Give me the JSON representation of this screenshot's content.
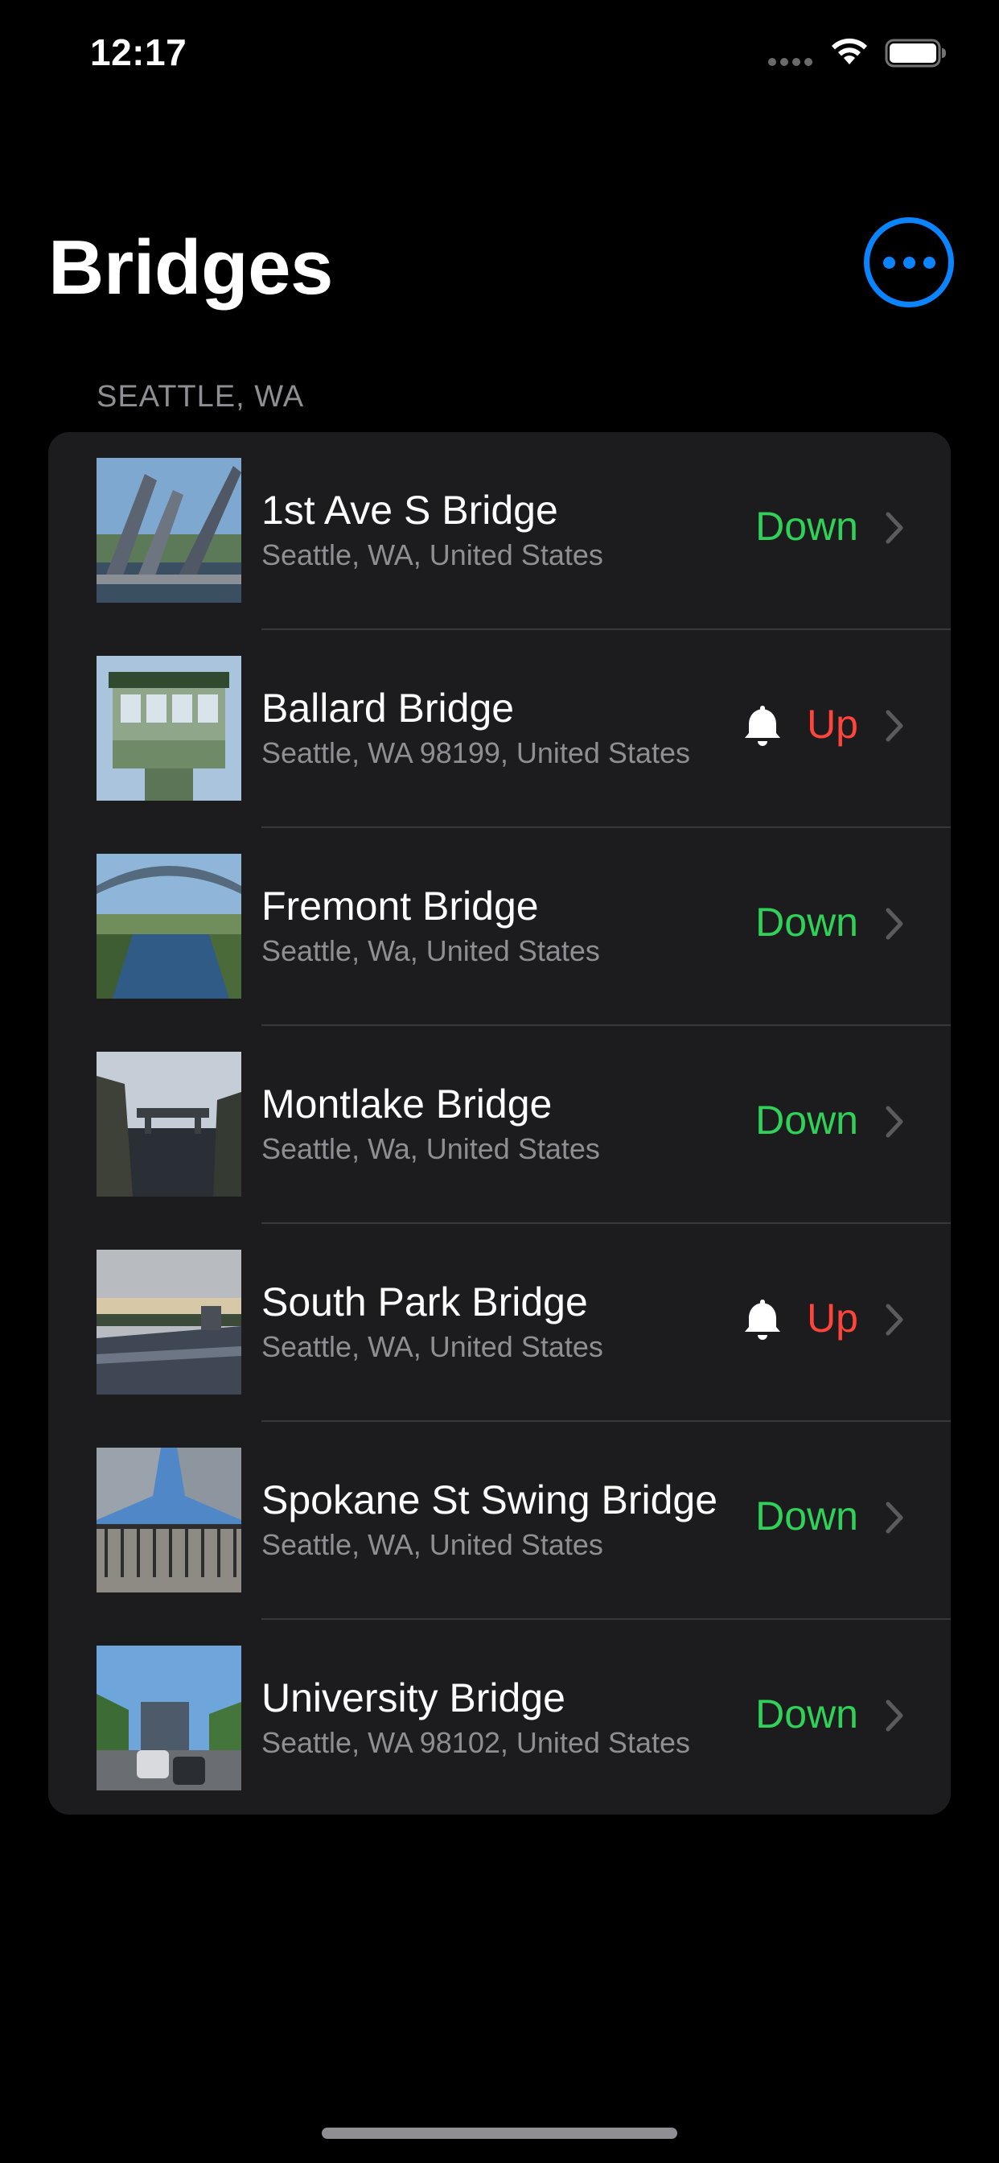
{
  "status_bar": {
    "time": "12:17"
  },
  "header": {
    "title": "Bridges",
    "more_button_icon": "ellipsis-circle-icon",
    "accent_color": "#0a84ff"
  },
  "section": {
    "title": "SEATTLE, WA"
  },
  "colors": {
    "down": "#30d158",
    "up": "#ff453a"
  },
  "bridges": [
    {
      "name": "1st Ave S Bridge",
      "address": "Seattle, WA, United States",
      "status": "Down",
      "notify": false
    },
    {
      "name": "Ballard Bridge",
      "address": "Seattle, WA 98199, United States",
      "status": "Up",
      "notify": true
    },
    {
      "name": "Fremont Bridge",
      "address": "Seattle, Wa, United States",
      "status": "Down",
      "notify": false
    },
    {
      "name": "Montlake Bridge",
      "address": "Seattle, Wa, United States",
      "status": "Down",
      "notify": false
    },
    {
      "name": "South Park Bridge",
      "address": "Seattle, WA, United States",
      "status": "Up",
      "notify": true
    },
    {
      "name": "Spokane St Swing Bridge",
      "address": "Seattle, WA, United States",
      "status": "Down",
      "notify": false
    },
    {
      "name": "University Bridge",
      "address": "Seattle, WA  98102, United States",
      "status": "Down",
      "notify": false
    }
  ]
}
